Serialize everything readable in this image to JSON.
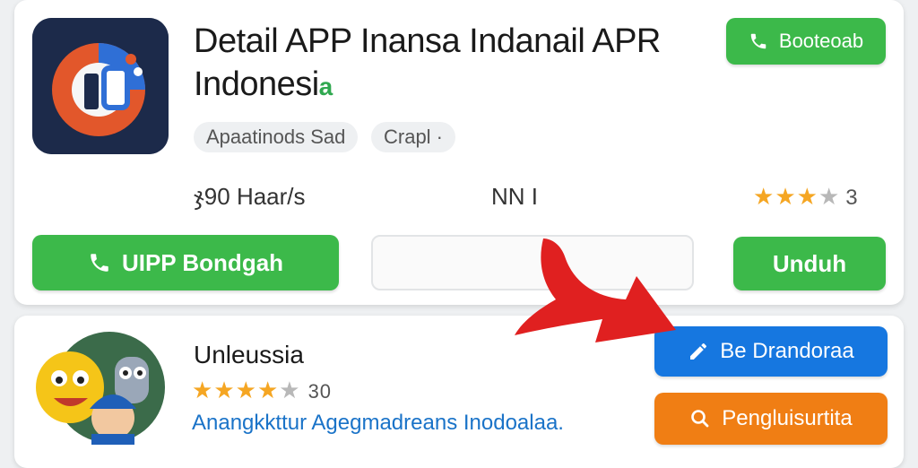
{
  "app_detail": {
    "title": "Detail APP Inansa Indanail APR Indonesi",
    "title_tail": "a",
    "chips": [
      "Apaatinods Sad",
      "Crapl ·"
    ],
    "size_text": "ჯ90 Haar/s",
    "mid_text": "NN I",
    "rating": {
      "filled": 3,
      "total": 4,
      "count": "3"
    },
    "top_button_label": "Booteoab",
    "main_button_label": "UIPP Bondgah",
    "download_button_label": "Unduh",
    "input_value": ""
  },
  "app_item": {
    "name": "Unleussia",
    "rating": {
      "filled": 4,
      "total": 5,
      "count": "30"
    },
    "description": "Anangkkttur Agegmadreans Inodoalaa.",
    "blue_button_label": "Be Drandoraa",
    "orange_button_label": "Pengluisurtita"
  },
  "colors": {
    "green": "#3cb94a",
    "blue": "#1677e0",
    "orange": "#f07e14",
    "star": "#f5a623",
    "arrow": "#e02020"
  },
  "icons": {
    "top_button": "phone-icon",
    "main_button": "phone-icon",
    "blue_button": "pen-icon",
    "orange_button": "search-icon"
  }
}
